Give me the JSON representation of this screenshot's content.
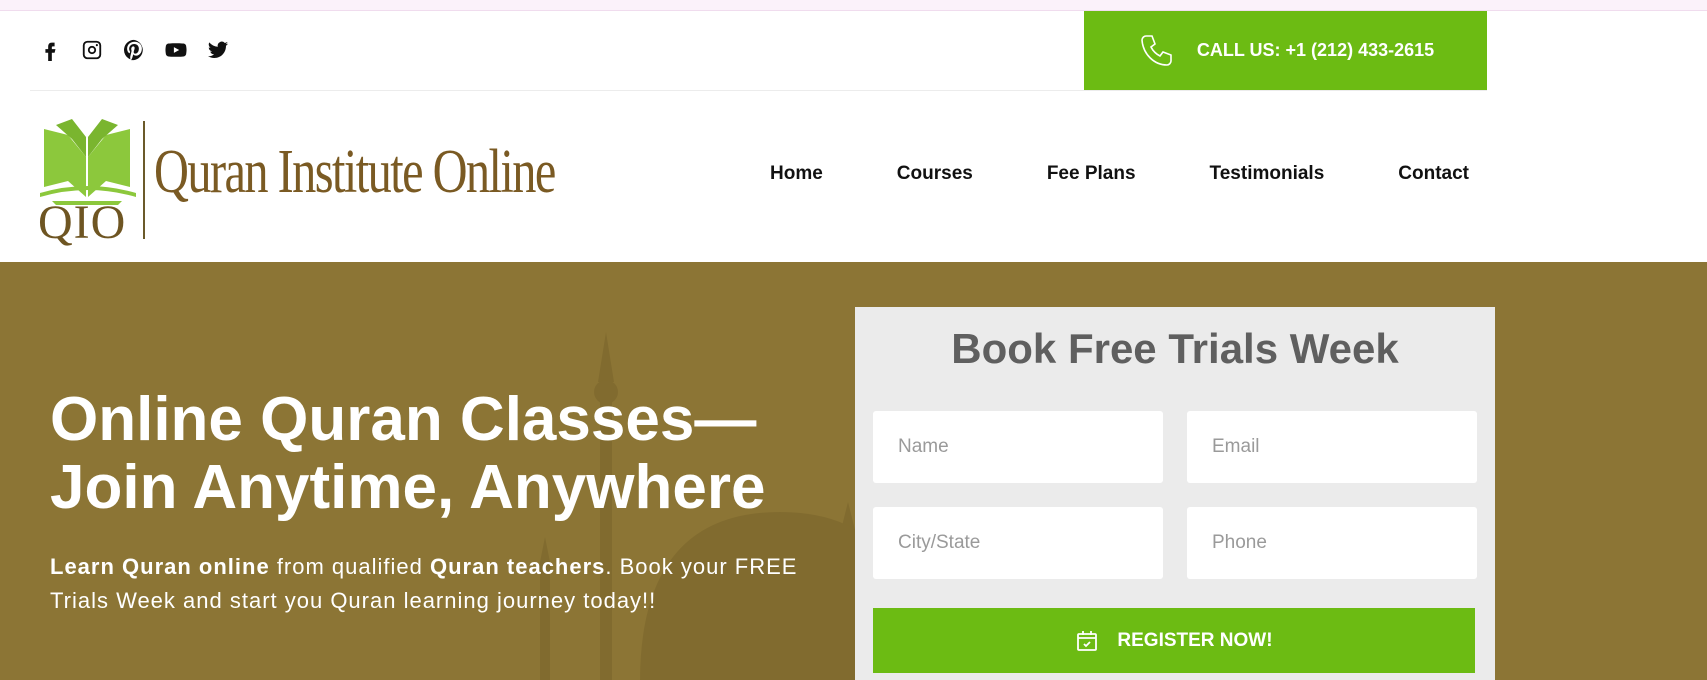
{
  "topbar": {
    "social_icons": [
      "facebook-icon",
      "instagram-icon",
      "pinterest-icon",
      "youtube-icon",
      "twitter-icon"
    ],
    "call_label": "CALL US: +1 (212) 433-2615"
  },
  "logo": {
    "abbr": "QIO",
    "name": "Quran Institute Online"
  },
  "nav": {
    "items": [
      "Home",
      "Courses",
      "Fee Plans",
      "Testimonials",
      "Contact"
    ]
  },
  "hero": {
    "title_line1": "Online Quran Classes—",
    "title_line2": "Join Anytime, Anywhere",
    "sub_bold1": "Learn Quran online",
    "sub_text1": " from qualified ",
    "sub_bold2": "Quran teachers",
    "sub_text2": ". Book your FREE Trials Week and start you Quran learning journey today!!"
  },
  "form": {
    "title": "Book Free Trials Week",
    "fields": {
      "name_placeholder": "Name",
      "email_placeholder": "Email",
      "city_placeholder": "City/State",
      "phone_placeholder": "Phone"
    },
    "register_label": "REGISTER NOW!"
  },
  "colors": {
    "accent_green": "#6cbb13",
    "hero_bg": "#8c7535",
    "logo_brown": "#7a5a23"
  }
}
